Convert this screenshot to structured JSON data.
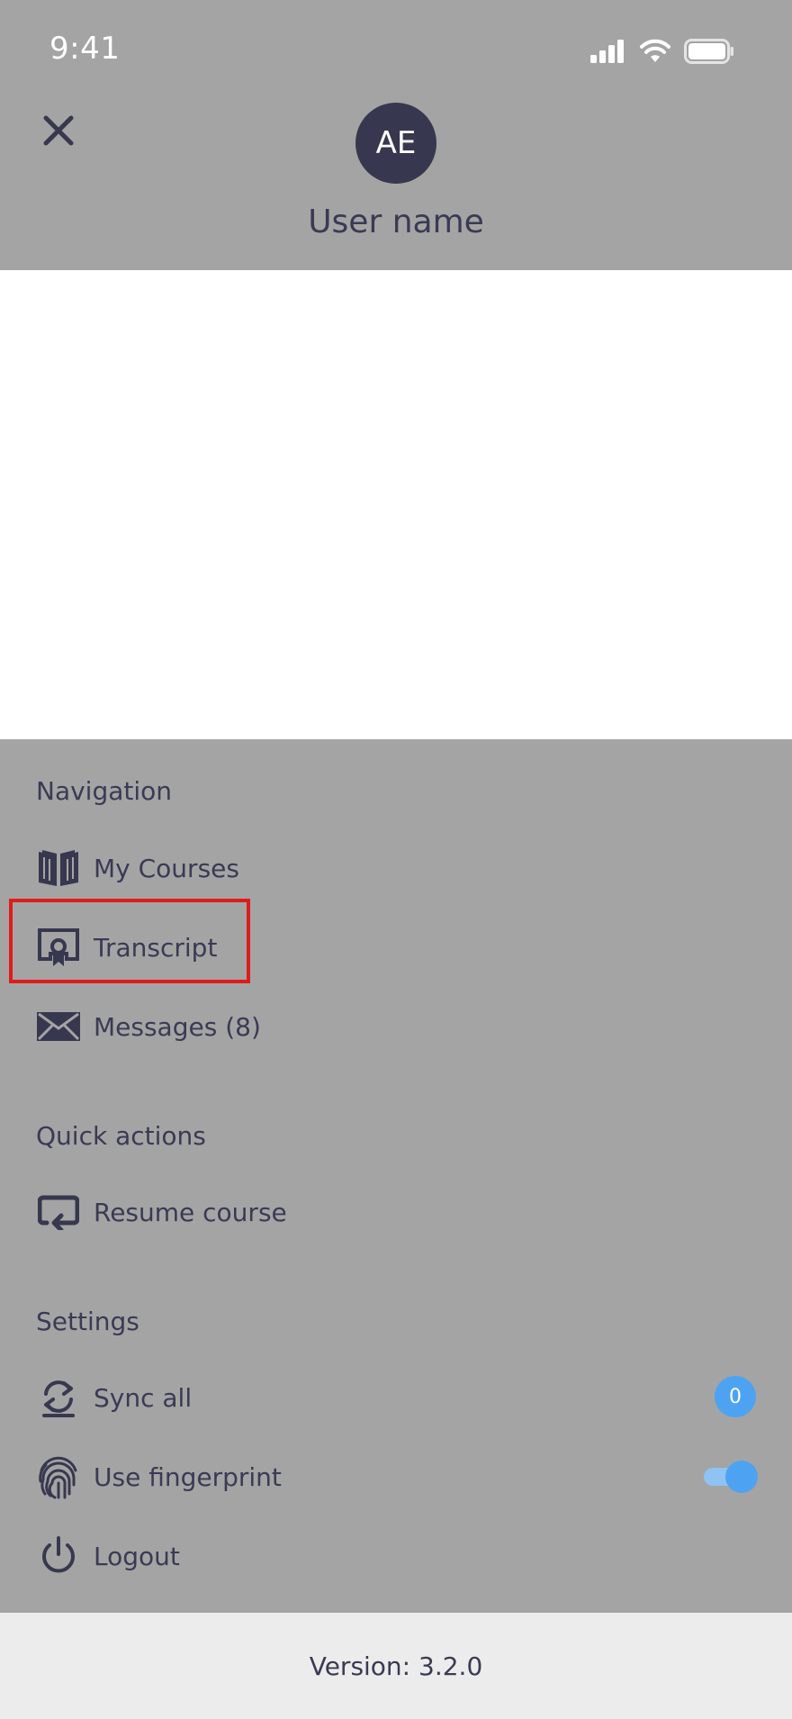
{
  "status_bar": {
    "time": "9:41"
  },
  "header": {
    "avatar_initials": "AE",
    "user_name": "User name"
  },
  "navigation": {
    "title": "Navigation",
    "items": [
      {
        "label": "My Courses",
        "icon": "book-icon"
      },
      {
        "label": "Transcript",
        "icon": "certificate-icon"
      },
      {
        "label": "Messages (8)",
        "icon": "envelope-icon"
      }
    ]
  },
  "quick_actions": {
    "title": "Quick actions",
    "items": [
      {
        "label": "Resume course",
        "icon": "repeat-icon"
      }
    ]
  },
  "settings": {
    "title": "Settings",
    "sync_all": {
      "label": "Sync all",
      "badge": "0"
    },
    "fingerprint": {
      "label": "Use fingerprint",
      "enabled": true
    },
    "logout": {
      "label": "Logout"
    }
  },
  "footer": {
    "version": "Version: 3.2.0"
  },
  "colors": {
    "accent": "#4da3f2",
    "text": "#3a3a55",
    "avatar": "#37374f",
    "highlight": "#e01b1b"
  }
}
